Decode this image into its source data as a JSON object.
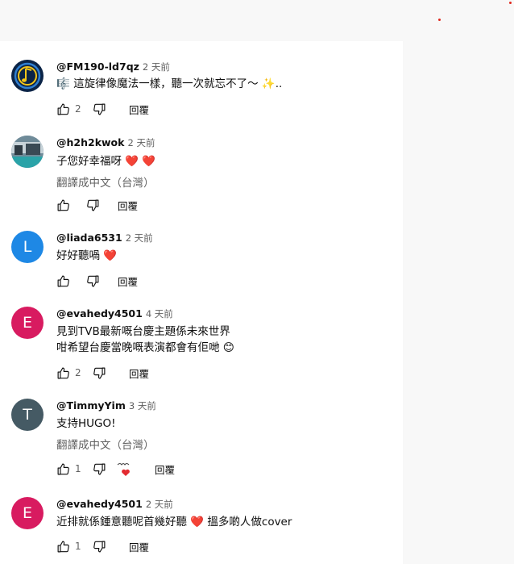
{
  "comments": [
    {
      "author": "@FM190-ld7qz",
      "time": "2 天前",
      "lines": [
        "🎼 這旋律像魔法一樣，聽一次就忘不了～ ✨.."
      ],
      "likes": "2",
      "reply": "回覆",
      "avatar": {
        "bg": "#0b2447",
        "letter": ""
      }
    },
    {
      "author": "@h2h2kwok",
      "time": "2 天前",
      "lines": [
        "子您好幸福呀 ❤️ ❤️"
      ],
      "translate": "翻譯成中文（台灣）",
      "likes": "",
      "reply": "回覆",
      "avatar": {
        "bg": "#5b7b8a",
        "letter": ""
      }
    },
    {
      "author": "@liada6531",
      "time": "2 天前",
      "lines": [
        "好好聽喎 ❤️"
      ],
      "likes": "",
      "reply": "回覆",
      "avatar": {
        "bg": "#1e88e5",
        "letter": "L"
      }
    },
    {
      "author": "@evahedy4501",
      "time": "4 天前",
      "lines": [
        "見到TVB最新嘅台慶主題係未來世界",
        "咁希望台慶當晚嘅表演都會有佢哋 😊"
      ],
      "likes": "2",
      "reply": "回覆",
      "avatar": {
        "bg": "#d81b60",
        "letter": "E"
      }
    },
    {
      "author": "@TimmyYim",
      "time": "3 天前",
      "lines": [
        "支持HUGO!"
      ],
      "translate": "翻譯成中文（台灣）",
      "likes": "1",
      "reply": "回覆",
      "creator_heart": true,
      "avatar": {
        "bg": "#455a64",
        "letter": "T"
      }
    },
    {
      "author": "@evahedy4501",
      "time": "2 天前",
      "lines": [
        "近排就係鍾意聽呢首幾好聽 ❤️ 搵多啲人做cover"
      ],
      "likes": "1",
      "reply": "回覆",
      "avatar": {
        "bg": "#d81b60",
        "letter": "E"
      }
    }
  ],
  "icons": {
    "like": "thumbs-up-icon",
    "dislike": "thumbs-down-icon",
    "creator_heart": "creator-heart-icon"
  },
  "colors": {
    "heart": "#e32a30",
    "secondary_text": "#606060",
    "panel_bg": "#f8f8f8"
  }
}
